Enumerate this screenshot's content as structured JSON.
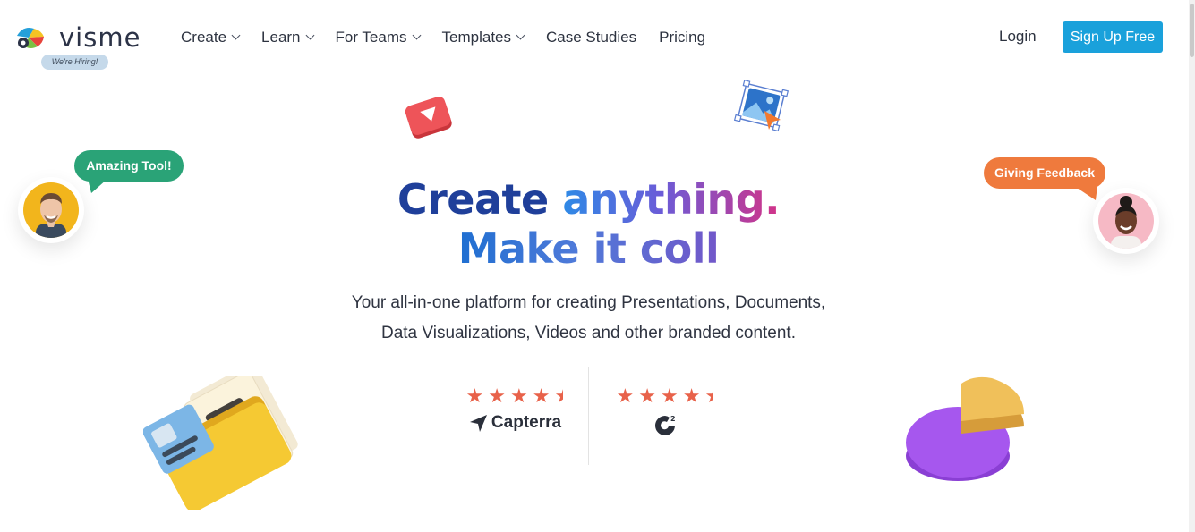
{
  "brand": {
    "name": "visme",
    "hiring_badge": "We're Hiring!"
  },
  "nav": {
    "items": [
      {
        "label": "Create",
        "has_dropdown": true
      },
      {
        "label": "Learn",
        "has_dropdown": true
      },
      {
        "label": "For Teams",
        "has_dropdown": true
      },
      {
        "label": "Templates",
        "has_dropdown": true
      },
      {
        "label": "Case Studies",
        "has_dropdown": false
      },
      {
        "label": "Pricing",
        "has_dropdown": false
      }
    ],
    "login": "Login",
    "signup": "Sign Up Free"
  },
  "hero": {
    "headline_word1": "Create",
    "headline_word2": "anything.",
    "headline_line2": "Make it coll",
    "subtitle_line1": "Your all-in-one platform for creating Presentations, Documents,",
    "subtitle_line2": "Data Visualizations, Videos and other branded content."
  },
  "bubbles": {
    "left": "Amazing Tool!",
    "right": "Giving Feedback"
  },
  "ratings": [
    {
      "source": "Capterra",
      "stars": 4.5
    },
    {
      "source": "G2",
      "stars": 4.5
    }
  ],
  "colors": {
    "accent": "#1aa1db",
    "headline_dark": "#1f3f9a",
    "star": "#e8624a",
    "bubble_green": "#2aa377",
    "bubble_orange": "#ef7a3d"
  },
  "icons": [
    "video-play-icon",
    "image-cursor-icon",
    "folder-illustration",
    "pie-chart-illustration",
    "capterra-arrow-icon"
  ]
}
